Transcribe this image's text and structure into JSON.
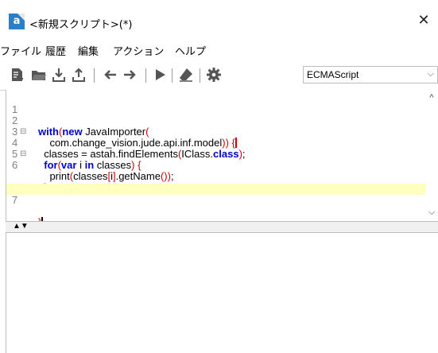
{
  "window": {
    "title": "<新規スクリプト>(*)",
    "close_label": "✕"
  },
  "menu": {
    "items": [
      "ファイル",
      "履歴",
      "編集",
      "アクション",
      "ヘルプ"
    ]
  },
  "toolbar": {
    "buttons": [
      "new-script-icon",
      "open-folder-icon",
      "import-icon",
      "export-icon",
      "undo-icon",
      "redo-icon",
      "run-icon",
      "clear-icon",
      "settings-icon"
    ],
    "language": {
      "value": "ECMAScript",
      "arrow": "⌵"
    }
  },
  "editor": {
    "lines": [
      {
        "num": "1",
        "fold": "",
        "code": "with(new JavaImporter("
      },
      {
        "num": "2",
        "fold": "⊟",
        "code": "    com.change_vision.jude.api.inf.model)) {"
      },
      {
        "num": "3",
        "fold": "",
        "code": "  classes = astah.findElements(IClass.class);"
      },
      {
        "num": "4",
        "fold": "⊟",
        "code": "  for(var i in classes) {"
      },
      {
        "num": "5",
        "fold": "",
        "code": "    print(classes[i].getName());"
      },
      {
        "num": "6",
        "fold": "",
        "code": "  }"
      },
      {
        "num": "7",
        "fold": "",
        "code": "}"
      }
    ],
    "current_line": 7
  },
  "scrollbar": {
    "up": "^",
    "down": "⌵"
  },
  "splitter": {
    "arrows": "▲▼"
  }
}
